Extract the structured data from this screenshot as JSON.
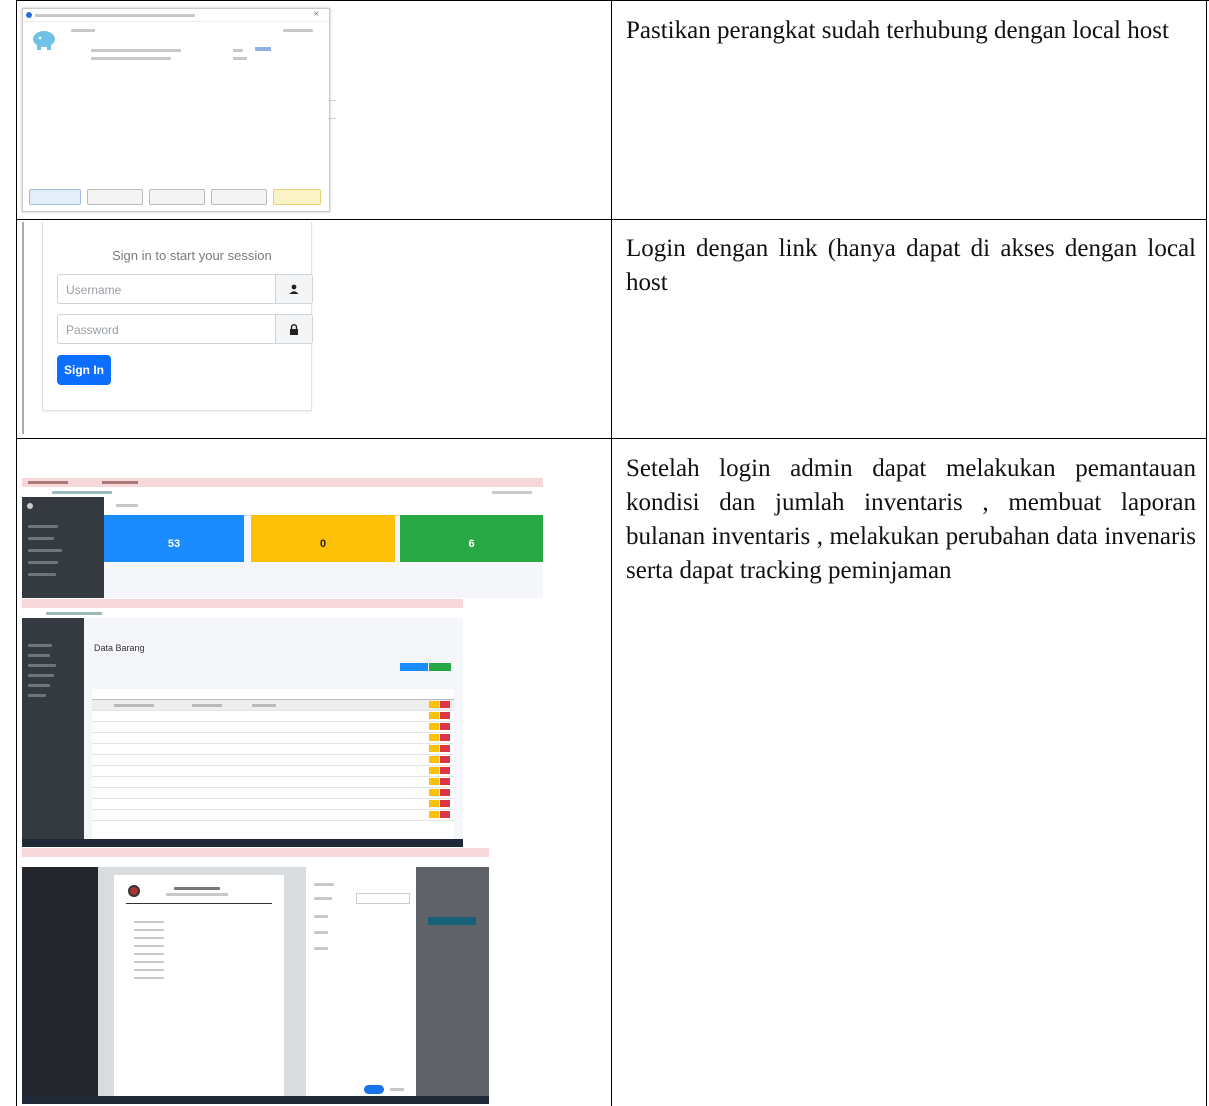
{
  "rows": [
    {
      "text": "Pastikan perangkat sudah terhubung dengan local host"
    },
    {
      "text": "Login dengan link (hanya dapat di akses dengan local host"
    },
    {
      "text": "Setelah login admin dapat melakukan pemantauan kondisi dan jumlah inventaris , membuat laporan bulanan inventaris , melakukan perubahan data invenaris serta dapat tracking peminjaman"
    }
  ],
  "login": {
    "title": "Sign in to start your session",
    "username_placeholder": "Username",
    "password_placeholder": "Password",
    "signin_label": "Sign In"
  },
  "dashboard": {
    "title": "Data Barang",
    "cards": [
      {
        "color": "#1a8cff",
        "value": "53"
      },
      {
        "color": "#ffc107",
        "value": "0"
      },
      {
        "color": "#28a745",
        "value": "6"
      }
    ]
  },
  "colors": {
    "signin": "#0d6efd",
    "sidebar": "#343a40",
    "edit": "#ffc107",
    "delete": "#dc3545"
  }
}
